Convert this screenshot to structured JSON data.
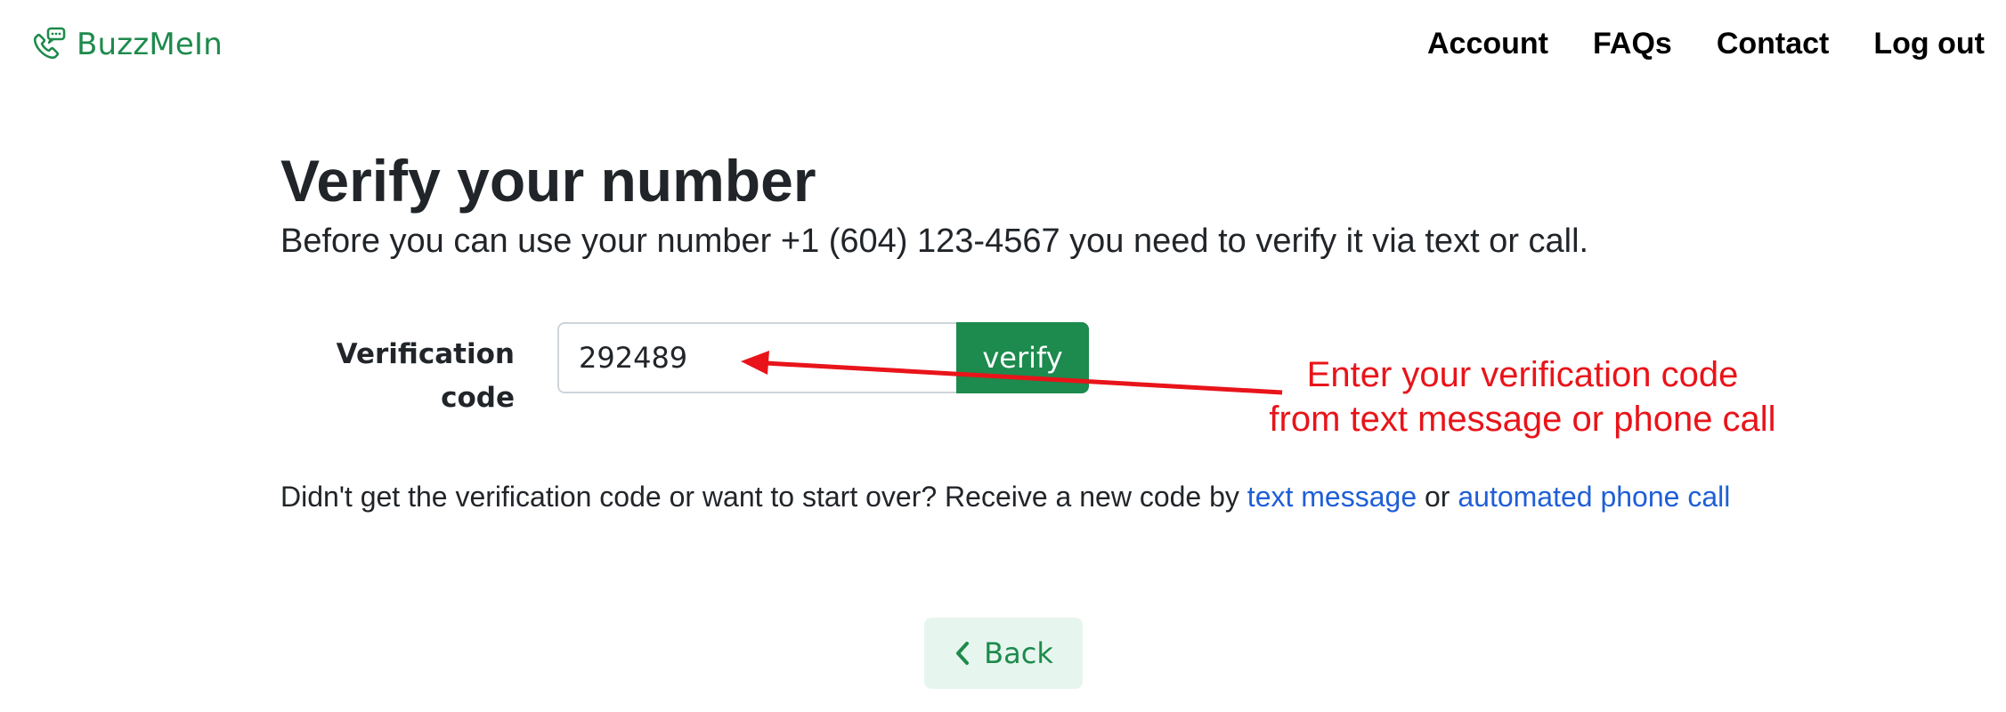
{
  "header": {
    "brand_name": "BuzzMeIn",
    "brand_icon": "phone-chat-icon",
    "brand_color": "#1e8a4c",
    "nav": [
      {
        "label": "Account"
      },
      {
        "label": "FAQs"
      },
      {
        "label": "Contact"
      },
      {
        "label": "Log out"
      }
    ]
  },
  "main": {
    "title": "Verify your number",
    "subtitle": "Before you can use your number +1 (604) 123-4567 you need to verify it via text or call.",
    "form": {
      "label_line1": "Verification",
      "label_line2": "code",
      "code_value": "292489",
      "verify_label": "verify",
      "verify_color": "#1d8a4e"
    },
    "help": {
      "text_before": "Didn't get the verification code or want to start over? Receive a new code by ",
      "link_text_message": "text message",
      "text_or": " or ",
      "link_phone_call": "automated phone call",
      "link_color": "#1f5fd6"
    },
    "back_label": "Back",
    "back_icon": "chevron-left-icon"
  },
  "annotation": {
    "line1": "Enter your verification code",
    "line2": "from text message or phone call",
    "color": "#e8141a"
  }
}
